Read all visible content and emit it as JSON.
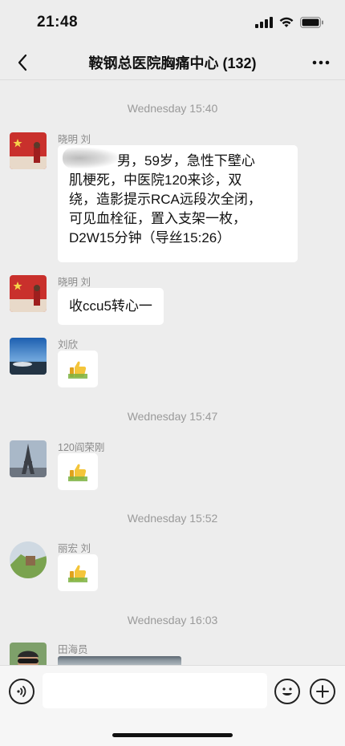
{
  "status_bar": {
    "time": "21:48"
  },
  "header": {
    "title": "鞍钢总医院胸痛中心 (132)"
  },
  "icons": {
    "back": "chevron-left-icon",
    "more": "more-dots-icon",
    "voice": "voice-icon",
    "emoji": "emoji-icon",
    "plus": "plus-icon",
    "thumbs_up": "thumbs-up-icon"
  },
  "chat": {
    "timestamps": [
      "Wednesday 15:40",
      "Wednesday 15:47",
      "Wednesday 15:52",
      "Wednesday 16:03"
    ],
    "messages": [
      {
        "sender": "晓明 刘",
        "text": "男，59岁，急性下壁心\n肌梗死，中医院120来诊，双\n绕，造影提示RCA远段次全闭，\n可见血栓征，置入支架一枚，\nD2W15分钟（导丝15:26）"
      },
      {
        "sender": "晓明 刘",
        "text": "收ccu5转心一"
      },
      {
        "sender": "刘欣",
        "text": ""
      },
      {
        "sender": "120阎荣刚",
        "text": ""
      },
      {
        "sender": "丽宏 刘",
        "text": ""
      },
      {
        "sender": "田海员",
        "text": ""
      }
    ]
  },
  "colors": {
    "background": "#ededed",
    "bubble": "#ffffff",
    "timestamp": "#9a9a9a"
  }
}
